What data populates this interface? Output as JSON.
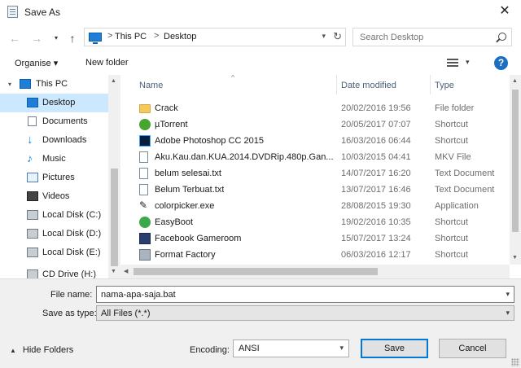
{
  "window": {
    "title": "Save As",
    "close": "✕"
  },
  "address": {
    "crumbs": [
      "This PC",
      "Desktop"
    ],
    "separator": ">"
  },
  "search": {
    "placeholder": "Search Desktop"
  },
  "toolbar": {
    "organise": "Organise ▾",
    "new_folder": "New folder",
    "help": "?"
  },
  "navpane": {
    "items": [
      {
        "label": "This PC",
        "icon": "pc-icon"
      },
      {
        "label": "Desktop",
        "icon": "desktop-icon",
        "selected": true
      },
      {
        "label": "Documents",
        "icon": "documents-icon"
      },
      {
        "label": "Downloads",
        "icon": "downloads-icon"
      },
      {
        "label": "Music",
        "icon": "music-icon"
      },
      {
        "label": "Pictures",
        "icon": "pictures-icon"
      },
      {
        "label": "Videos",
        "icon": "videos-icon"
      },
      {
        "label": "Local Disk (C:)",
        "icon": "disk-icon"
      },
      {
        "label": "Local Disk (D:)",
        "icon": "disk-icon"
      },
      {
        "label": "Local Disk (E:)",
        "icon": "disk-icon"
      },
      {
        "label": "CD Drive (H:)",
        "icon": "cd-drive-icon"
      }
    ]
  },
  "columns": {
    "name": "Name",
    "date": "Date modified",
    "type": "Type"
  },
  "files": [
    {
      "name": "Crack",
      "date": "20/02/2016 19:56",
      "type": "File folder",
      "icon": "folder-icon"
    },
    {
      "name": "µTorrent",
      "date": "20/05/2017 07:07",
      "type": "Shortcut",
      "icon": "utorrent-icon"
    },
    {
      "name": "Adobe Photoshop CC 2015",
      "date": "16/03/2016 06:44",
      "type": "Shortcut",
      "icon": "photoshop-icon"
    },
    {
      "name": "Aku.Kau.dan.KUA.2014.DVDRip.480p.Gan...",
      "date": "10/03/2015 04:41",
      "type": "MKV File",
      "icon": "video-file-icon"
    },
    {
      "name": "belum selesai.txt",
      "date": "14/07/2017 16:20",
      "type": "Text Document",
      "icon": "text-file-icon"
    },
    {
      "name": "Belum Terbuat.txt",
      "date": "13/07/2017 16:46",
      "type": "Text Document",
      "icon": "text-file-icon"
    },
    {
      "name": "colorpicker.exe",
      "date": "28/08/2015 19:30",
      "type": "Application",
      "icon": "colorpicker-icon"
    },
    {
      "name": "EasyBoot",
      "date": "19/02/2016 10:35",
      "type": "Shortcut",
      "icon": "easyboot-icon"
    },
    {
      "name": "Facebook Gameroom",
      "date": "15/07/2017 13:24",
      "type": "Shortcut",
      "icon": "facebook-gameroom-icon"
    },
    {
      "name": "Format Factory",
      "date": "06/03/2016 12:17",
      "type": "Shortcut",
      "icon": "format-factory-icon"
    }
  ],
  "form": {
    "file_name_label": "File name:",
    "file_name_value": "nama-apa-saja.bat",
    "save_as_type_label": "Save as type:",
    "save_as_type_value": "All Files  (*.*)",
    "encoding_label": "Encoding:",
    "encoding_value": "ANSI"
  },
  "footer": {
    "hide_folders": "Hide Folders",
    "save": "Save",
    "cancel": "Cancel"
  }
}
